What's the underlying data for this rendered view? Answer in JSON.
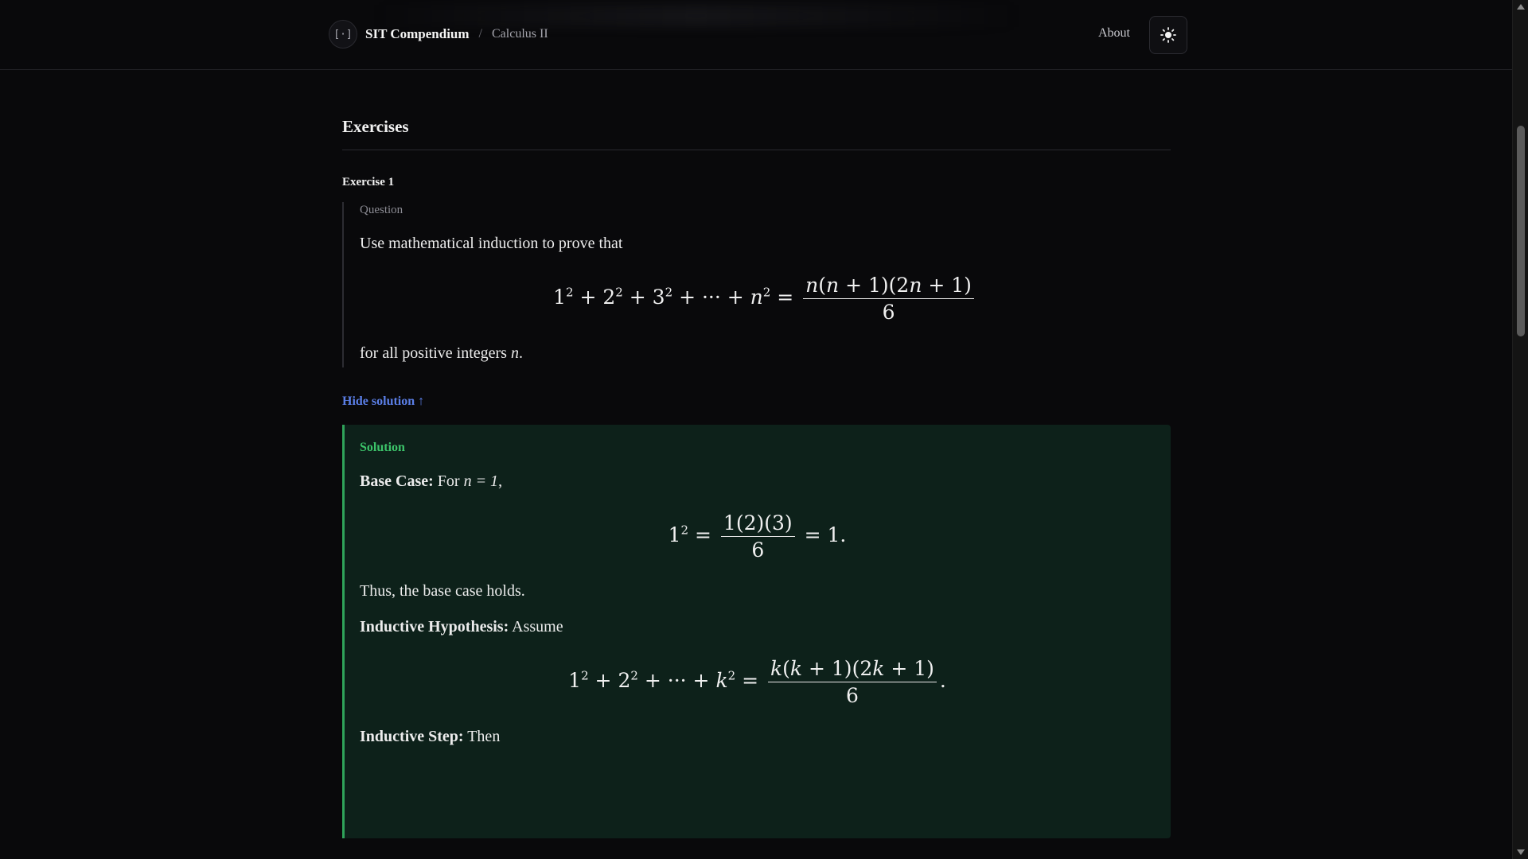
{
  "header": {
    "logo_text": "[·]",
    "brand": "SIT Compendium",
    "separator": "/",
    "crumb": "Calculus II",
    "about": "About",
    "theme_icon": "sun-icon"
  },
  "section": {
    "title": "Exercises"
  },
  "exercise": {
    "title": "Exercise 1",
    "question_label": "Question",
    "intro": "Use mathematical induction to prove that",
    "outro_prefix": "for all positive integers ",
    "outro_var": "n",
    "outro_suffix": "."
  },
  "hide_solution": "Hide solution ↑",
  "solution": {
    "label": "Solution",
    "base_title": "Base Case:",
    "base_text": "For ",
    "base_math": "n = 1",
    "base_comma": ",",
    "base_holds": "Thus, the base case holds.",
    "hyp_title": "Inductive Hypothesis:",
    "hyp_text": "Assume",
    "step_title": "Inductive Step:",
    "step_text": "Then"
  },
  "colors": {
    "background": "#09090b",
    "link": "#5b7fe8",
    "solution_accent": "#2fa35a",
    "solution_bg": "#0d211a"
  }
}
